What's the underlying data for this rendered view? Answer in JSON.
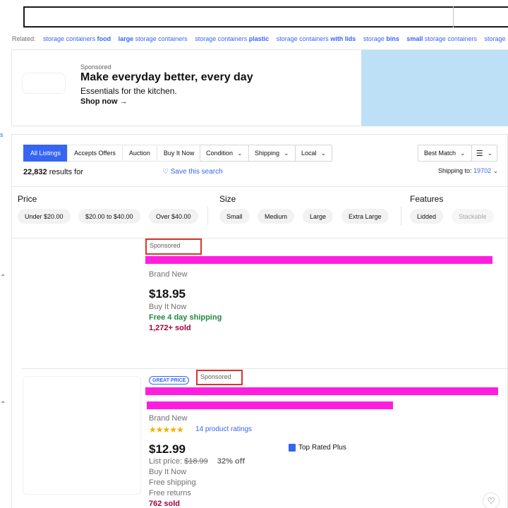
{
  "related": {
    "label": "Related:",
    "links": [
      {
        "pre": "storage containers ",
        "bold": "food",
        "post": ""
      },
      {
        "pre": "",
        "bold": "large",
        "post": " storage containers"
      },
      {
        "pre": "storage containers ",
        "bold": "plastic",
        "post": ""
      },
      {
        "pre": "storage containers ",
        "bold": "with lids",
        "post": ""
      },
      {
        "pre": "storage ",
        "bold": "bins",
        "post": ""
      },
      {
        "pre": "",
        "bold": "small",
        "post": " storage containers"
      },
      {
        "pre": "storage",
        "bold": "",
        "post": ""
      }
    ]
  },
  "banner": {
    "sponsored": "Sponsored",
    "title": "Make everyday better, every day",
    "subtitle": "Essentials for the kitchen.",
    "cta": "Shop now →"
  },
  "tabs": [
    "All Listings",
    "Accepts Offers",
    "Auction",
    "Buy It Now"
  ],
  "filters": {
    "condition": "Condition",
    "shipping": "Shipping",
    "local": "Local",
    "sort": "Best Match"
  },
  "results": {
    "count": "22,832",
    "suffix": " results for",
    "save": "Save this search",
    "ship_label": "Shipping to:",
    "zip": "19702"
  },
  "facets": {
    "price": {
      "label": "Price",
      "options": [
        "Under $20.00",
        "$20.00 to $40.00",
        "Over $40.00"
      ]
    },
    "size": {
      "label": "Size",
      "options": [
        "Small",
        "Medium",
        "Large",
        "Extra Large"
      ]
    },
    "features": {
      "label": "Features",
      "options": [
        "Lidded",
        "Stackable"
      ]
    }
  },
  "items": [
    {
      "sponsored": "Sponsored",
      "condition": "Brand New",
      "price": "$18.95",
      "format": "Buy It Now",
      "shipping": "Free 4 day shipping",
      "sold": "1,272+ sold"
    },
    {
      "badge": "GREAT PRICE",
      "sponsored": "Sponsored",
      "condition": "Brand New",
      "stars": "★★★★★",
      "ratings": "14 product ratings",
      "top_rated": "Top Rated Plus",
      "price": "$12.99",
      "list_label": "List price:",
      "list_price": "$18.99",
      "discount": "32% off",
      "format": "Buy It Now",
      "shipping": "Free shipping",
      "returns": "Free returns",
      "sold": "762 sold"
    }
  ],
  "colors": {
    "accent": "#3665f3",
    "redaction": "#ff1ee0",
    "sold": "#a2003d",
    "free_ship": "#1e8a3e",
    "annotation": "#d9342c"
  }
}
